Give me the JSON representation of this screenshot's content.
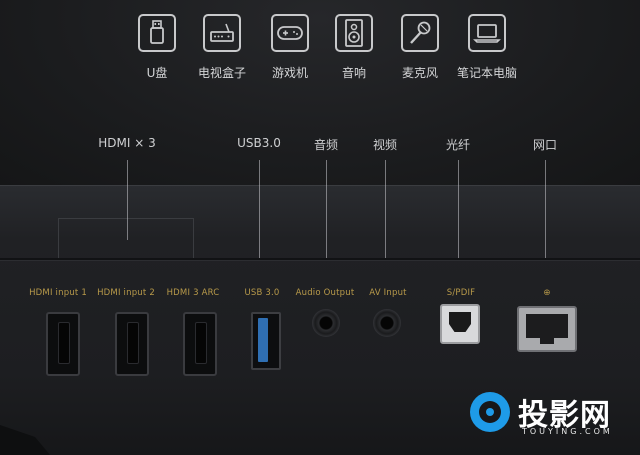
{
  "devices": [
    {
      "label": "U盘",
      "icon": "usb-drive-icon"
    },
    {
      "label": "电视盒子",
      "icon": "tv-box-icon"
    },
    {
      "label": "游戏机",
      "icon": "gamepad-icon"
    },
    {
      "label": "音响",
      "icon": "speaker-icon"
    },
    {
      "label": "麦克风",
      "icon": "microphone-icon"
    },
    {
      "label": "笔记本电脑",
      "icon": "laptop-icon"
    }
  ],
  "port_labels": [
    "HDMI × 3",
    "USB3.0",
    "音频",
    "视频",
    "光纤",
    "网口"
  ],
  "panel_silk": {
    "hdmi1": "HDMI input 1",
    "hdmi2": "HDMI input 2",
    "hdmi3": "HDMI 3 ARC",
    "usb": "USB 3.0",
    "audio": "Audio Output",
    "av": "AV Input",
    "spdif": "S/PDIF",
    "lan": "⊕"
  },
  "watermark": {
    "text": "投影网",
    "sub": "TOUYING.COM"
  },
  "colors": {
    "silk": "#b89a4a",
    "usb_blue": "#2f6fb3",
    "logo_blue": "#1e9be8"
  }
}
